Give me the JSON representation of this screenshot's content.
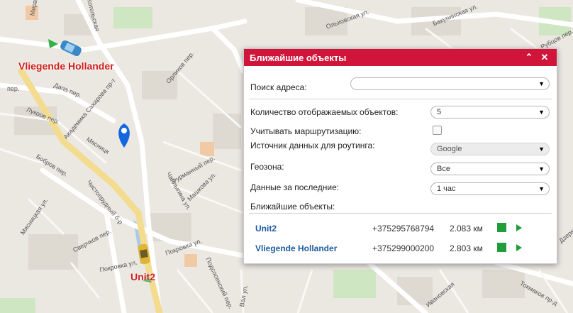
{
  "map": {
    "streets": [
      "Мира",
      "Котельская",
      "Ольховская ул.",
      "Бакунинская ул.",
      "Рубцов пер.",
      "пер.",
      "Дапа пер.",
      "Орликов пер.",
      "Лукоов пер.",
      "Академика Сахарова пр-т",
      "Мясницк",
      "Бобров пер.",
      "Фурманный пер.",
      "Мясницкая ул.",
      "Чистопрудный б-р",
      "Чаплыгина ул.",
      "Машкова ул.",
      "Покровка ул.",
      "Сверчков пер.",
      "Покровка ул.",
      "Подсосенский пер.",
      "Вал ул.",
      "Токмаков пр-д",
      "Дзерки",
      "Ивановская"
    ],
    "units_on_map": [
      {
        "label": "Vliegende Hollander"
      },
      {
        "label": "Unit2"
      }
    ]
  },
  "panel": {
    "title": "Ближайшие объекты",
    "collapse_icon": "double-chevron-up-icon",
    "close_icon": "close-icon",
    "address_label": "Поиск адреса:",
    "address_value": "",
    "count_label": "Количество отображаемых объектов:",
    "count_value": "5",
    "routing_label": "Учитывать маршрутизацию:",
    "routing_checked": false,
    "source_label": "Источник данных для роутинга:",
    "source_value": "Google",
    "geozone_label": "Геозона:",
    "geozone_value": "Все",
    "period_label": "Данные за последние:",
    "period_value": "1 час",
    "results_label": "Ближайшие объекты:",
    "results": [
      {
        "name": "Unit2",
        "phone": "+375295768794",
        "distance": "2.083 км"
      },
      {
        "name": "Vliegende Hollander",
        "phone": "+375299000200",
        "distance": "2.803 км"
      }
    ],
    "accent_color": "#d0143a",
    "action_color": "#1f9e3a"
  }
}
